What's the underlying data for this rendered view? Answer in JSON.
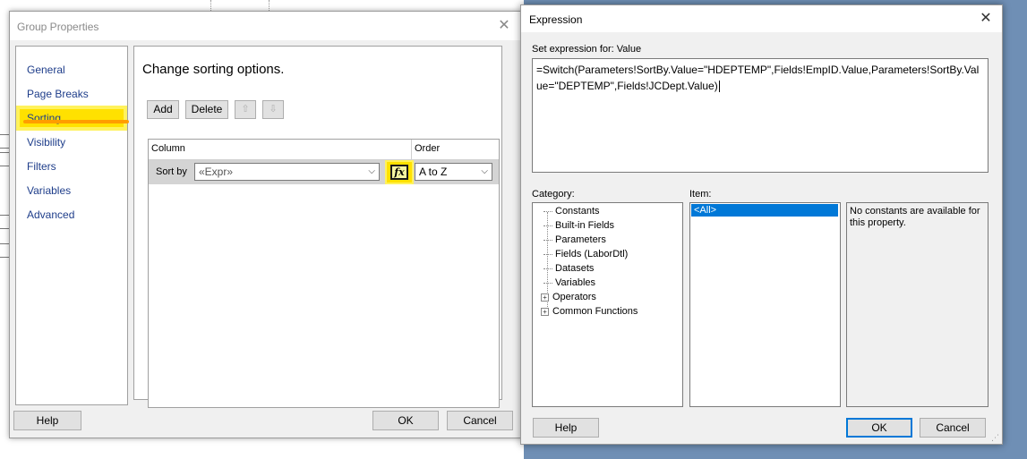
{
  "group_properties": {
    "title": "Group Properties",
    "nav_items": [
      "General",
      "Page Breaks",
      "Sorting",
      "Visibility",
      "Filters",
      "Variables",
      "Advanced"
    ],
    "active_nav": "Sorting",
    "heading": "Change sorting options.",
    "toolbar": {
      "add_label": "Add",
      "delete_label": "Delete",
      "move_up_icon": "arrow-up-icon",
      "move_down_icon": "arrow-down-icon"
    },
    "grid": {
      "column_header": "Column",
      "order_header": "Order",
      "rows": [
        {
          "label": "Sort by",
          "column_value": "«Expr»",
          "order_value": "A to Z"
        }
      ]
    },
    "fx_button_icon": "fx-icon",
    "fx_glyph": "fx",
    "help_label": "Help",
    "ok_label": "OK",
    "cancel_label": "Cancel",
    "highlight_color": "#ffe100"
  },
  "expression_dialog": {
    "title": "Expression",
    "set_expression_label": "Set expression for: Value",
    "expression": "=Switch(Parameters!SortBy.Value=\"HDEPTEMP\",Fields!EmpID.Value,Parameters!SortBy.Value=\"DEPTEMP\",Fields!JCDept.Value)",
    "category_label": "Category:",
    "item_label": "Item:",
    "categories": [
      "Constants",
      "Built-in Fields",
      "Parameters",
      "Fields (LaborDtl)",
      "Datasets",
      "Variables"
    ],
    "expandable_categories": [
      "Operators",
      "Common Functions"
    ],
    "items": [
      "<All>"
    ],
    "description": "No constants are available for this property.",
    "help_label": "Help",
    "ok_label": "OK",
    "cancel_label": "Cancel",
    "selection_color": "#0078d7"
  }
}
